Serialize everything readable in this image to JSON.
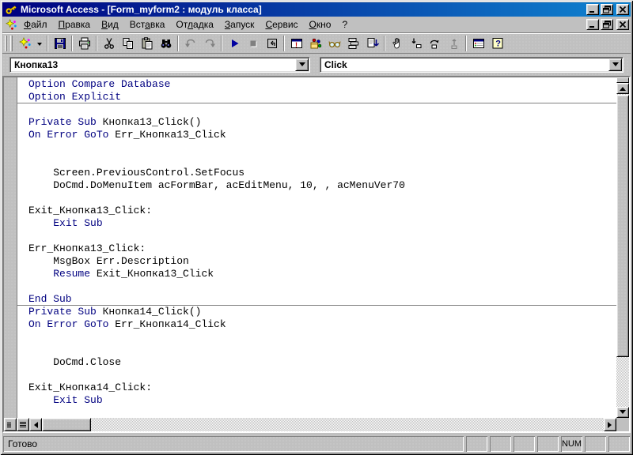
{
  "window": {
    "title": "Microsoft Access - [Form_myform2 : модуль класса]",
    "app_icon": "access-key-icon"
  },
  "colors": {
    "chrome": "#c0c0c0",
    "title_gradient_start": "#000080",
    "title_gradient_end": "#1084d0",
    "keyword": "#000080",
    "code_background": "#ffffff",
    "run_icon": "#0000a0"
  },
  "menu": {
    "items": [
      {
        "label": "Файл",
        "u": 0
      },
      {
        "label": "Правка",
        "u": 0
      },
      {
        "label": "Вид",
        "u": 0
      },
      {
        "label": "Вставка",
        "u": 3
      },
      {
        "label": "Отладка",
        "u": 2
      },
      {
        "label": "Запуск",
        "u": 0
      },
      {
        "label": "Сервис",
        "u": 0
      },
      {
        "label": "Окно",
        "u": 0
      },
      {
        "label": "?",
        "u": -1
      }
    ]
  },
  "toolbar": {
    "icons": [
      "new-object-icon",
      "dropdown-arrow-icon",
      "save-icon",
      "print-icon",
      "cut-icon",
      "copy-icon",
      "paste-icon",
      "find-icon",
      "undo-icon",
      "redo-icon",
      "run-icon",
      "stop-icon",
      "reset-icon",
      "debug-window-icon",
      "object-browser-icon",
      "quick-watch-icon",
      "call-stack-icon",
      "compile-icon",
      "toggle-breakpoint-hand-icon",
      "step-into-icon",
      "step-over-icon",
      "step-out-icon",
      "database-window-icon",
      "help-icon"
    ]
  },
  "object_combo": {
    "value": "Кнопка13"
  },
  "event_combo": {
    "value": "Click"
  },
  "code": {
    "keyword_color": "#000080",
    "lines": [
      {
        "segments": [
          {
            "type": "kw",
            "text": "Option Compare Database"
          }
        ]
      },
      {
        "segments": [
          {
            "type": "kw",
            "text": "Option Explicit"
          }
        ],
        "separator_after": true
      },
      {
        "segments": []
      },
      {
        "segments": [
          {
            "type": "kw",
            "text": "Private Sub "
          },
          {
            "type": "plain",
            "text": "Кнопка13_Click()"
          }
        ]
      },
      {
        "segments": [
          {
            "type": "kw",
            "text": "On Error GoTo "
          },
          {
            "type": "plain",
            "text": "Err_Кнопка13_Click"
          }
        ]
      },
      {
        "segments": []
      },
      {
        "segments": []
      },
      {
        "segments": [
          {
            "type": "plain",
            "text": "    Screen.PreviousControl.SetFocus"
          }
        ]
      },
      {
        "segments": [
          {
            "type": "plain",
            "text": "    DoCmd.DoMenuItem acFormBar, acEditMenu, 10, , acMenuVer70"
          }
        ]
      },
      {
        "segments": []
      },
      {
        "segments": [
          {
            "type": "plain",
            "text": "Exit_Кнопка13_Click:"
          }
        ]
      },
      {
        "segments": [
          {
            "type": "plain",
            "text": "    "
          },
          {
            "type": "kw",
            "text": "Exit Sub"
          }
        ]
      },
      {
        "segments": []
      },
      {
        "segments": [
          {
            "type": "plain",
            "text": "Err_Кнопка13_Click:"
          }
        ]
      },
      {
        "segments": [
          {
            "type": "plain",
            "text": "    MsgBox Err.Description"
          }
        ]
      },
      {
        "segments": [
          {
            "type": "plain",
            "text": "    "
          },
          {
            "type": "kw",
            "text": "Resume"
          },
          {
            "type": "plain",
            "text": " Exit_Кнопка13_Click"
          }
        ]
      },
      {
        "segments": []
      },
      {
        "segments": [
          {
            "type": "kw",
            "text": "End Sub"
          }
        ],
        "separator_after": true
      },
      {
        "segments": [
          {
            "type": "kw",
            "text": "Private Sub "
          },
          {
            "type": "plain",
            "text": "Кнопка14_Click()"
          }
        ]
      },
      {
        "segments": [
          {
            "type": "kw",
            "text": "On Error GoTo "
          },
          {
            "type": "plain",
            "text": "Err_Кнопка14_Click"
          }
        ]
      },
      {
        "segments": []
      },
      {
        "segments": []
      },
      {
        "segments": [
          {
            "type": "plain",
            "text": "    DoCmd.Close"
          }
        ]
      },
      {
        "segments": []
      },
      {
        "segments": [
          {
            "type": "plain",
            "text": "Exit_Кнопка14_Click:"
          }
        ]
      },
      {
        "segments": [
          {
            "type": "plain",
            "text": "    "
          },
          {
            "type": "kw",
            "text": "Exit Sub"
          }
        ]
      },
      {
        "segments": []
      }
    ]
  },
  "status": {
    "ready": "Готово",
    "panels": [
      "",
      "",
      "",
      "",
      "NUM",
      "",
      ""
    ]
  }
}
